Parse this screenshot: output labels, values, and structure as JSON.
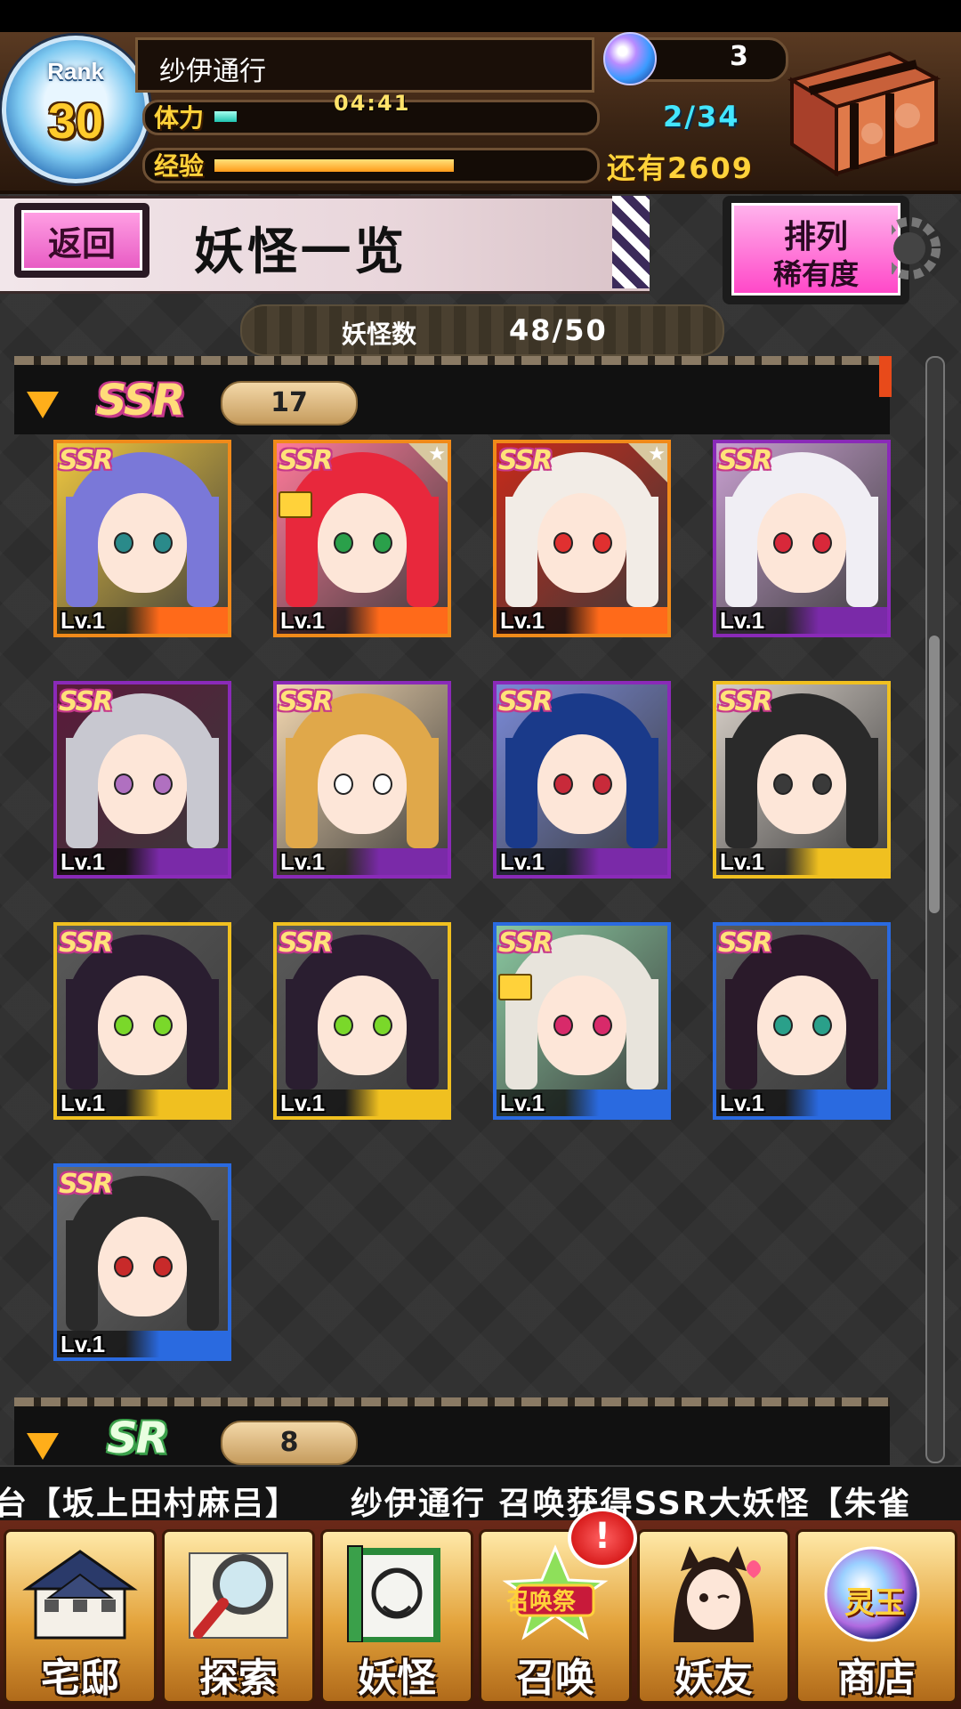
{
  "header": {
    "rank_label": "Rank",
    "rank": "30",
    "player_name": "纱伊通行",
    "stamina_label": "体力",
    "stamina_timer": "04:41",
    "stamina_count": "2/34",
    "stamina_fraction": 0.06,
    "orb_count": "3",
    "exp_label": "经验",
    "exp_remaining": "还有2609",
    "exp_fraction": 0.64
  },
  "title_bar": {
    "back_label": "返回",
    "title": "妖怪一览",
    "sort_label": "排列",
    "sort_value": "稀有度"
  },
  "count": {
    "label": "妖怪数",
    "value": "48/50"
  },
  "sections": [
    {
      "rarity": "SSR",
      "count": "17"
    },
    {
      "rarity": "SR",
      "count": "8"
    }
  ],
  "cards": [
    {
      "tag": "SSR",
      "level": "Lv.1",
      "frame": "#f08a1a",
      "bar": "#ff6a1a",
      "hair": "#7a78d8",
      "bg": "#f0c840",
      "eyes": "#2a8a8a",
      "star": false,
      "locked": false
    },
    {
      "tag": "SSR",
      "level": "Lv.1",
      "frame": "#f08a1a",
      "bar": "#ff6a1a",
      "hair": "#e8283c",
      "bg": "#ff7a9a",
      "eyes": "#2aa04a",
      "star": true,
      "locked": true
    },
    {
      "tag": "SSR",
      "level": "Lv.1",
      "frame": "#f08a1a",
      "bar": "#ff6a1a",
      "hair": "#f2ece6",
      "bg": "#c82a1a",
      "eyes": "#e03030",
      "star": true,
      "locked": false
    },
    {
      "tag": "SSR",
      "level": "Lv.1",
      "frame": "#8a2ab8",
      "bar": "#7a2aa8",
      "hair": "#f0eef4",
      "bg": "#c8a0d0",
      "eyes": "#d8283a",
      "star": false,
      "locked": false
    },
    {
      "tag": "SSR",
      "level": "Lv.1",
      "frame": "#8a2ab8",
      "bar": "#7a2aa8",
      "hair": "#c8c8d0",
      "bg": "#5a1a3a",
      "eyes": "#b070c0",
      "star": false,
      "locked": false
    },
    {
      "tag": "SSR",
      "level": "Lv.1",
      "frame": "#8a2ab8",
      "bar": "#7a2aa8",
      "hair": "#e0a84a",
      "bg": "#f4d8b0",
      "eyes": "#ffffff",
      "star": false,
      "locked": false
    },
    {
      "tag": "SSR",
      "level": "Lv.1",
      "frame": "#8a2ab8",
      "bar": "#7a2aa8",
      "hair": "#1a3a8a",
      "bg": "#7a8ad8",
      "eyes": "#c82a3a",
      "star": false,
      "locked": false
    },
    {
      "tag": "SSR",
      "level": "Lv.1",
      "frame": "#f0c020",
      "bar": "#f0c020",
      "hair": "#2a2a2a",
      "bg": "#d8d0c8",
      "eyes": "#3a3a3a",
      "star": false,
      "locked": false
    },
    {
      "tag": "SSR",
      "level": "Lv.1",
      "frame": "#f0c020",
      "bar": "#f0c020",
      "hair": "#2a1e30",
      "bg": "#5a5a5a",
      "eyes": "#7ad82a",
      "star": false,
      "locked": false
    },
    {
      "tag": "SSR",
      "level": "Lv.1",
      "frame": "#f0c020",
      "bar": "#f0c020",
      "hair": "#2a1e30",
      "bg": "#5a5a5a",
      "eyes": "#7ad82a",
      "star": false,
      "locked": false
    },
    {
      "tag": "SSR",
      "level": "Lv.1",
      "frame": "#2a6ae0",
      "bar": "#2a6ae0",
      "hair": "#e8e4dc",
      "bg": "#8ac8a0",
      "eyes": "#d82a6a",
      "star": false,
      "locked": true
    },
    {
      "tag": "SSR",
      "level": "Lv.1",
      "frame": "#2a6ae0",
      "bar": "#2a6ae0",
      "hair": "#2a1a2a",
      "bg": "#5a5a5a",
      "eyes": "#2aa08a",
      "star": false,
      "locked": false
    },
    {
      "tag": "SSR",
      "level": "Lv.1",
      "frame": "#2a6ae0",
      "bar": "#2a6ae0",
      "hair": "#2a2a2a",
      "bg": "#6a6a6a",
      "eyes": "#c82a2a",
      "star": false,
      "locked": false
    }
  ],
  "ticker": "台【坂上田村麻吕】　　纱伊通行 召唤获得SSR大妖怪【朱雀",
  "nav": [
    {
      "label": "宅邸",
      "icon": "house-icon"
    },
    {
      "label": "探索",
      "icon": "magnifier-icon"
    },
    {
      "label": "妖怪",
      "icon": "scroll-icon"
    },
    {
      "label": "召唤",
      "icon": "summon-festival-icon",
      "sub": "召唤祭"
    },
    {
      "label": "妖友",
      "icon": "friend-girl-icon"
    },
    {
      "label": "商店",
      "icon": "spirit-orb-icon",
      "sub": "灵玉"
    }
  ],
  "summon_badge": "!"
}
